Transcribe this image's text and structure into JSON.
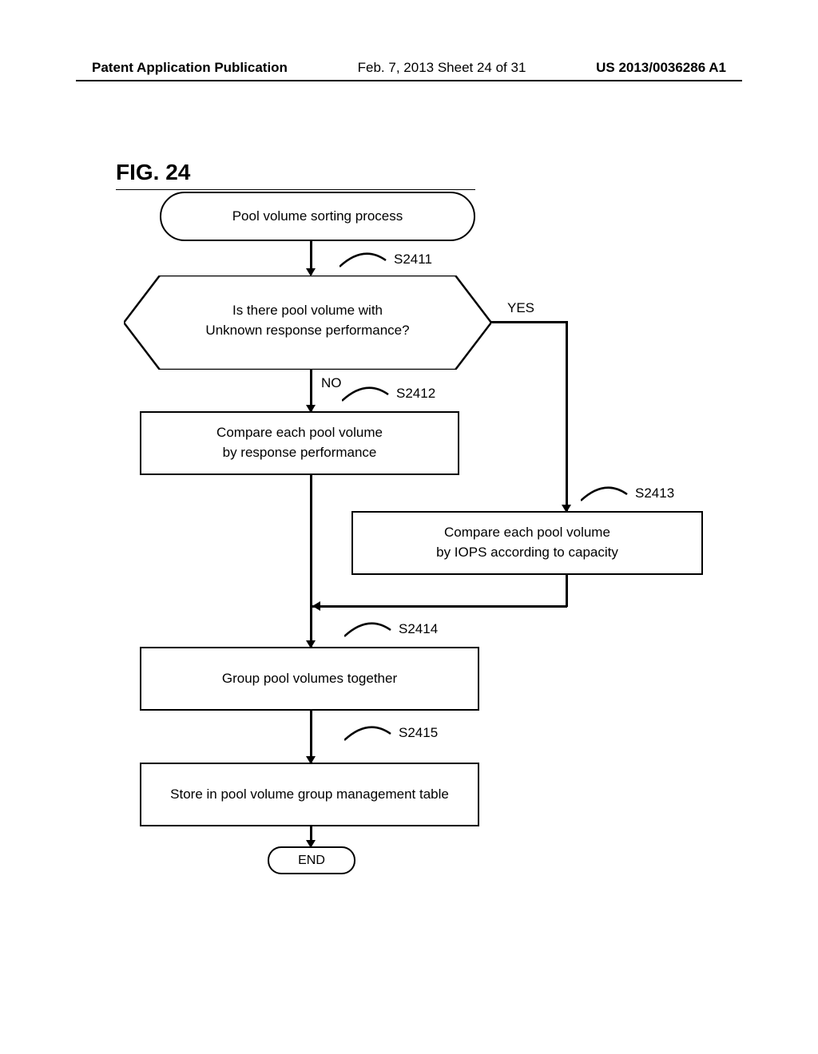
{
  "header": {
    "left": "Patent Application Publication",
    "center": "Feb. 7, 2013  Sheet 24 of 31",
    "right": "US 2013/0036286 A1"
  },
  "figure_label": "FIG. 24",
  "flowchart": {
    "start": "Pool volume sorting process",
    "decision": {
      "line1": "Is there pool volume with",
      "line2": "Unknown response performance?",
      "yes": "YES",
      "no": "NO"
    },
    "steps": {
      "s2411": "S2411",
      "s2412": "S2412",
      "s2413": "S2413",
      "s2414": "S2414",
      "s2415": "S2415"
    },
    "boxes": {
      "b1_line1": "Compare each pool volume",
      "b1_line2": "by response performance",
      "b2_line1": "Compare each pool volume",
      "b2_line2": "by IOPS according to capacity",
      "b3": "Group pool volumes together",
      "b4": "Store in pool volume group management table"
    },
    "end": "END"
  }
}
